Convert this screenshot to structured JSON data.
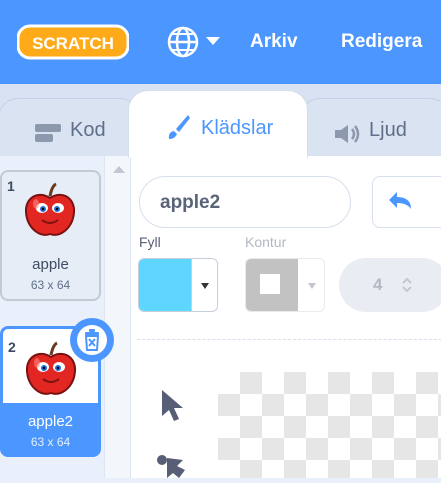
{
  "menubar": {
    "logo_text": "SCRATCH",
    "language_icon": "globe-icon",
    "file_label": "Arkiv",
    "edit_label": "Redigera"
  },
  "tabs": [
    {
      "label": "Kod",
      "icon": "code-blocks-icon",
      "active": false
    },
    {
      "label": "Klädslar",
      "icon": "paintbrush-icon",
      "active": true
    },
    {
      "label": "Ljud",
      "icon": "speaker-icon",
      "active": false
    }
  ],
  "costumes": [
    {
      "number": "1",
      "name": "apple",
      "size": "63 x 64",
      "selected": false
    },
    {
      "number": "2",
      "name": "apple2",
      "size": "63 x 64",
      "selected": true
    }
  ],
  "editor": {
    "costume_name": "apple2",
    "fill_label": "Fyll",
    "outline_label": "Kontur",
    "fill_color": "#5ed6ff",
    "outline_color": "#b3b3b3",
    "outline_width": "4"
  },
  "colors": {
    "brand_blue": "#4c97ff",
    "apple_red": "#e22622"
  }
}
